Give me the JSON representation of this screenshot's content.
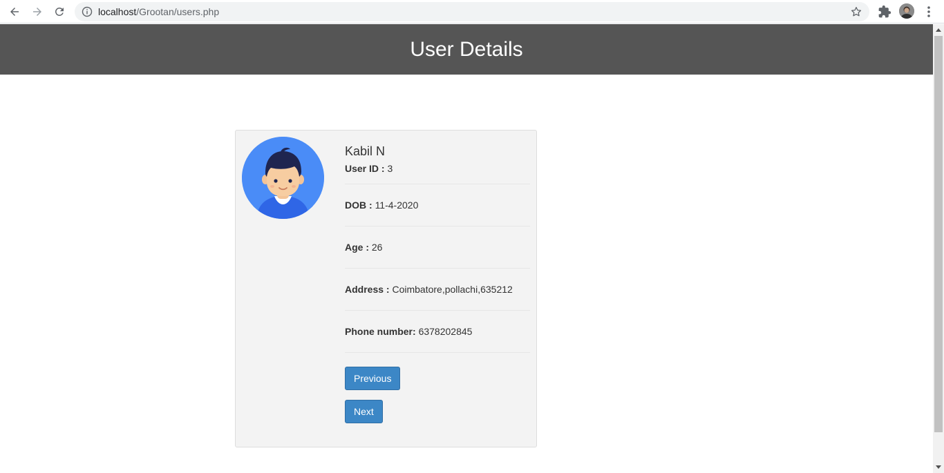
{
  "browser": {
    "url_host": "localhost",
    "url_path": "/Grootan/users.php"
  },
  "header": {
    "title": "User Details"
  },
  "user": {
    "name": "Kabil N",
    "user_id_label": "User ID : ",
    "user_id": "3",
    "dob_label": "DOB : ",
    "dob": "11-4-2020",
    "age_label": "Age : ",
    "age": "26",
    "address_label": "Address : ",
    "address": "Coimbatore,pollachi,635212",
    "phone_label": "Phone number: ",
    "phone": "6378202845"
  },
  "buttons": {
    "previous": "Previous",
    "next": "Next"
  },
  "colors": {
    "header_bg": "#555555",
    "button_bg": "#3c87c6",
    "card_bg": "#f3f3f3"
  }
}
